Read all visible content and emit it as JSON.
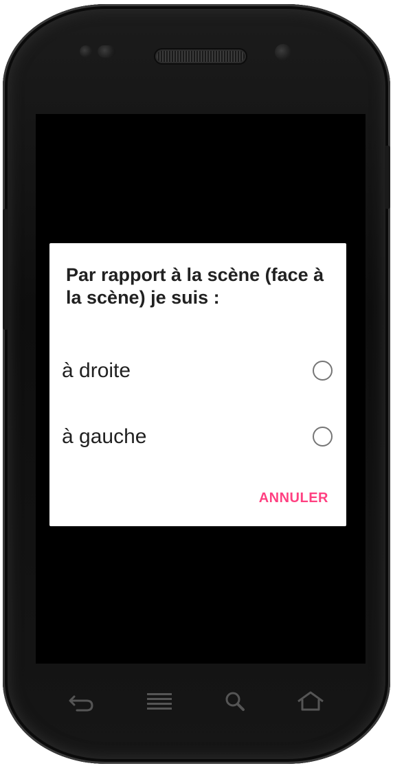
{
  "dialog": {
    "title": "Par rapport à la scène (face à la scène) je suis :",
    "options": [
      {
        "label": "à droite",
        "selected": false
      },
      {
        "label": "à gauche",
        "selected": false
      }
    ],
    "cancel_label": "ANNULER"
  },
  "colors": {
    "accent": "#ff4081",
    "dialog_bg": "#ffffff",
    "screen_bg": "#000000"
  },
  "navbar": {
    "buttons": [
      "back-icon",
      "menu-icon",
      "search-icon",
      "home-icon"
    ]
  }
}
